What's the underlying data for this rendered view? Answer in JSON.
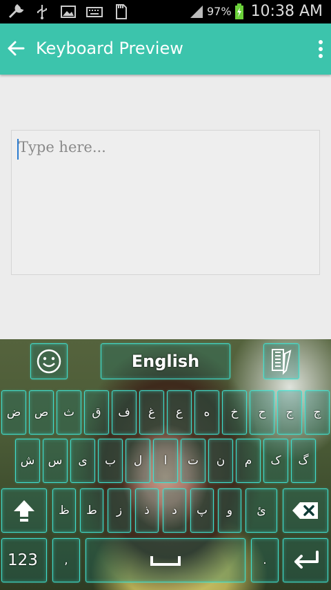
{
  "status_bar": {
    "battery_percent": "97%",
    "time": "10:38 AM",
    "icons": [
      "wrench-icon",
      "usb-icon",
      "image-icon",
      "keyboard-icon",
      "sd-card-icon",
      "signal-icon",
      "battery-charging-icon"
    ]
  },
  "app_bar": {
    "title": "Keyboard Preview",
    "back_icon": "arrow-left-icon",
    "menu_icon": "more-vert-icon"
  },
  "editor": {
    "placeholder": "Type here..."
  },
  "keyboard": {
    "language_label": "English",
    "row1": [
      "ض",
      "ص",
      "ث",
      "ق",
      "ف",
      "غ",
      "ع",
      "ه",
      "خ",
      "ح",
      "ج",
      "چ"
    ],
    "row2": [
      "ش",
      "س",
      "ی",
      "ب",
      "ل",
      "ا",
      "ت",
      "ن",
      "م",
      "ک",
      "گ"
    ],
    "row3": [
      "ظ",
      "ط",
      "ز",
      "ذ",
      "د",
      "پ",
      "و",
      "ئ"
    ],
    "numbers_label": "123",
    "comma_label": ",",
    "period_label": ".",
    "icons": [
      "emoji-icon",
      "keyboard-theme-icon",
      "shift-icon",
      "backspace-icon",
      "space-bar-icon",
      "enter-icon"
    ],
    "accent_color": "#3fe0d0"
  },
  "colors": {
    "app_bar": "#3cc4ac",
    "background": "#ececec"
  }
}
